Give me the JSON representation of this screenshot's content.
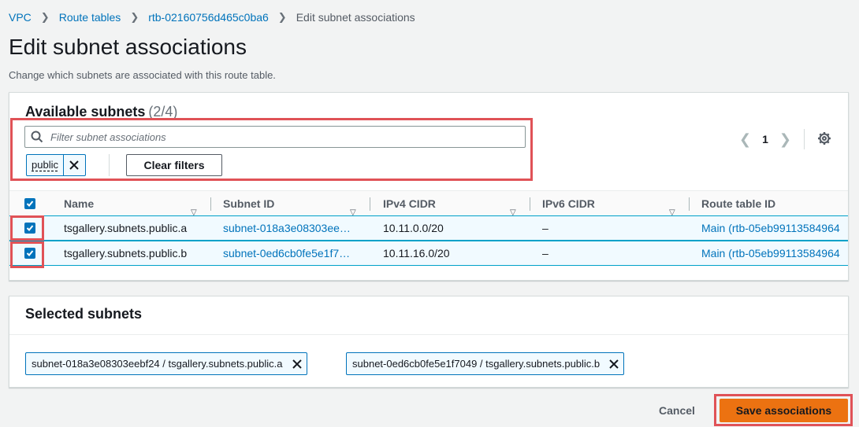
{
  "breadcrumb": [
    "VPC",
    "Route tables",
    "rtb-02160756d465c0ba6",
    "Edit subnet associations"
  ],
  "page": {
    "title": "Edit subnet associations",
    "subtitle": "Change which subnets are associated with this route table."
  },
  "available": {
    "title": "Available subnets",
    "count": "(2/4)",
    "filter_placeholder": "Filter subnet associations",
    "filter_token": "public",
    "clear_filters_label": "Clear filters",
    "page_number": "1",
    "columns": [
      "Name",
      "Subnet ID",
      "IPv4 CIDR",
      "IPv6 CIDR",
      "Route table ID"
    ],
    "rows": [
      {
        "checked": true,
        "name": "tsgallery.subnets.public.a",
        "subnet_id": "subnet-018a3e08303ee…",
        "ipv4": "10.11.0.0/20",
        "ipv6": "–",
        "route_table": "Main (rtb-05eb99113584964"
      },
      {
        "checked": true,
        "name": "tsgallery.subnets.public.b",
        "subnet_id": "subnet-0ed6cb0fe5e1f7…",
        "ipv4": "10.11.16.0/20",
        "ipv6": "–",
        "route_table": "Main (rtb-05eb99113584964"
      }
    ]
  },
  "selected": {
    "title": "Selected subnets",
    "chips": [
      "subnet-018a3e08303eebf24 / tsgallery.subnets.public.a",
      "subnet-0ed6cb0fe5e1f7049 / tsgallery.subnets.public.b"
    ]
  },
  "actions": {
    "cancel_label": "Cancel",
    "save_label": "Save associations"
  },
  "icons": [
    "search-icon",
    "close-icon",
    "chevron-left-icon",
    "chevron-right-icon",
    "gear-icon",
    "caret-down-icon",
    "checkbox-checked-icon"
  ],
  "colors": {
    "link": "#0073bb",
    "primary": "#ec7211",
    "highlight": "#e05257",
    "row_selected": "#f1faff"
  }
}
